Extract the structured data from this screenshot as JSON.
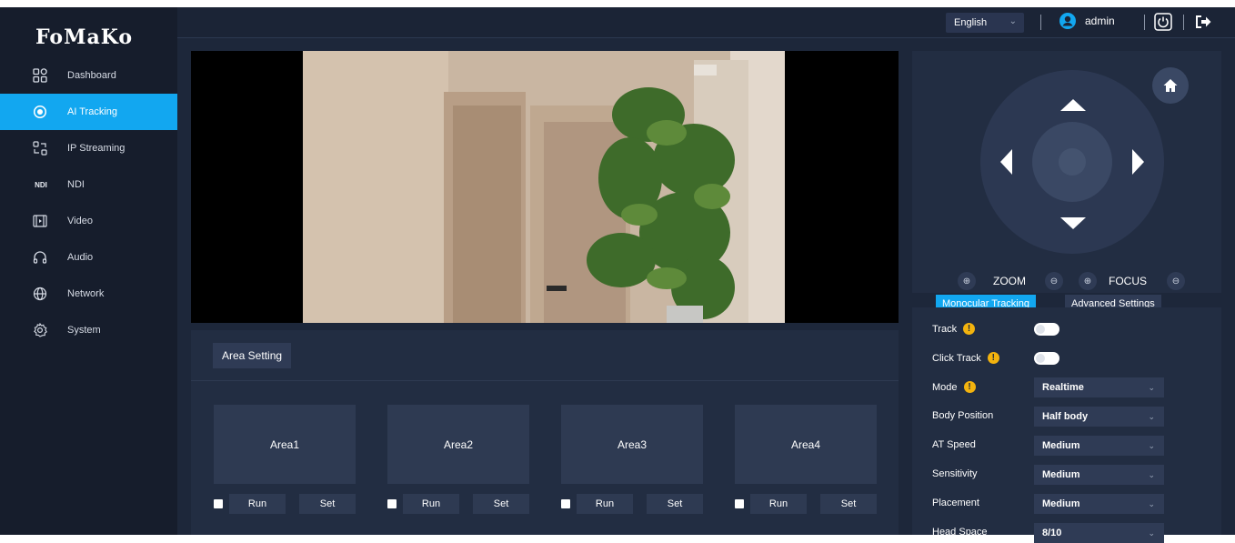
{
  "app": {
    "logo": "FoMaKo"
  },
  "sidebar": {
    "items": [
      {
        "label": "Dashboard",
        "icon": "dashboard-icon",
        "active": false
      },
      {
        "label": "AI Tracking",
        "icon": "target-icon",
        "active": true
      },
      {
        "label": "IP Streaming",
        "icon": "streaming-icon",
        "active": false
      },
      {
        "label": "NDI",
        "icon": "ndi-icon",
        "active": false,
        "icon_text": "NDI"
      },
      {
        "label": "Video",
        "icon": "video-icon",
        "active": false
      },
      {
        "label": "Audio",
        "icon": "headphones-icon",
        "active": false
      },
      {
        "label": "Network",
        "icon": "globe-icon",
        "active": false
      },
      {
        "label": "System",
        "icon": "gear-icon",
        "active": false
      }
    ]
  },
  "header": {
    "language": "English",
    "username": "admin",
    "icons": [
      "user-avatar-icon",
      "power-icon",
      "logout-icon"
    ]
  },
  "area_panel": {
    "title": "Area Setting",
    "areas": [
      {
        "label": "Area1",
        "run": "Run",
        "set": "Set",
        "checked": false
      },
      {
        "label": "Area2",
        "run": "Run",
        "set": "Set",
        "checked": false
      },
      {
        "label": "Area3",
        "run": "Run",
        "set": "Set",
        "checked": false
      },
      {
        "label": "Area4",
        "run": "Run",
        "set": "Set",
        "checked": false
      }
    ]
  },
  "ptz": {
    "zoom_label": "ZOOM",
    "focus_label": "FOCUS",
    "icons": [
      "arrow-up-icon",
      "arrow-down-icon",
      "arrow-left-icon",
      "arrow-right-icon",
      "home-icon",
      "zoom-in-icon",
      "zoom-out-icon",
      "focus-in-icon",
      "focus-out-icon"
    ]
  },
  "tracking": {
    "tabs": [
      "Monocular Tracking",
      "Advanced Settings"
    ],
    "track_label": "Track",
    "click_track_label": "Click Track",
    "mode_label": "Mode",
    "mode_value": "Realtime",
    "body_position_label": "Body Position",
    "body_position_value": "Half body",
    "at_speed_label": "AT Speed",
    "at_speed_value": "Medium",
    "sensitivity_label": "Sensitivity",
    "sensitivity_value": "Medium",
    "placement_label": "Placement",
    "placement_value": "Medium",
    "head_space_label": "Head Space",
    "head_space_value": "8/10",
    "info_mark": "!"
  },
  "colors": {
    "accent": "#12a7f0",
    "sidebar": "#161d2c",
    "background": "#1d273a",
    "panel": "#222d42",
    "info": "#f3b30e"
  }
}
